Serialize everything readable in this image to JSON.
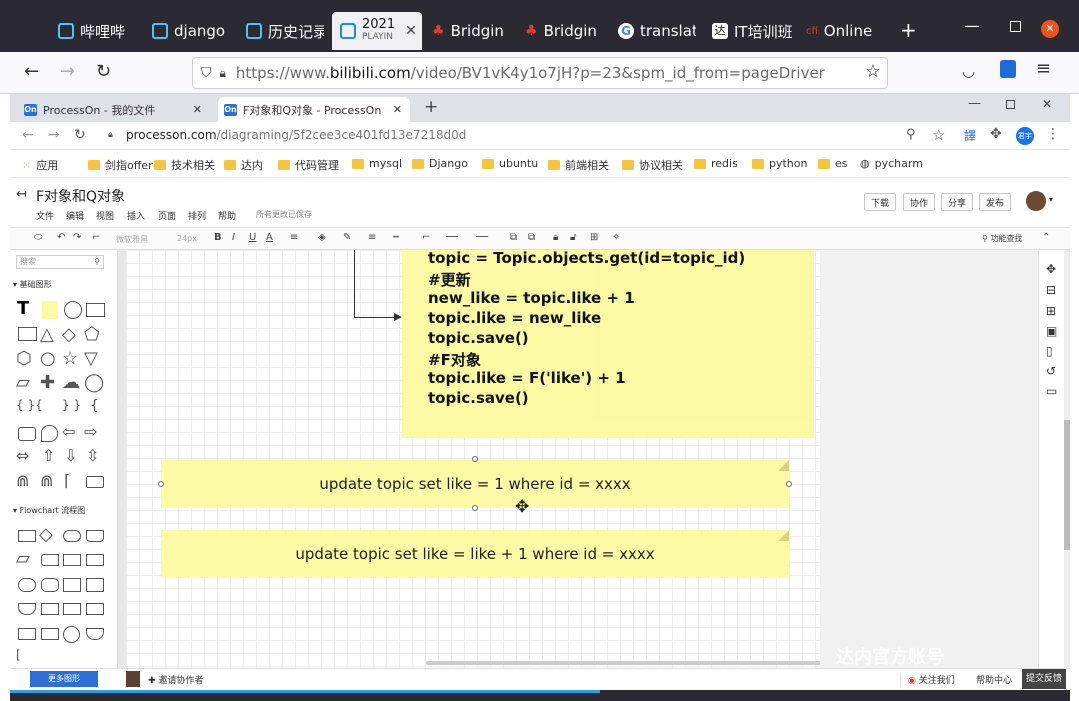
{
  "firefox": {
    "tabs": [
      {
        "label": "哔哩哔",
        "icon": "bilibili-icon"
      },
      {
        "label": "django",
        "icon": "bilibili-icon"
      },
      {
        "label": "历史记录",
        "icon": "bilibili-icon"
      },
      {
        "label": "2021",
        "sub": "PLAYIN",
        "icon": "bilibili-icon",
        "active": true
      },
      {
        "label": "Bridgin",
        "icon": "maple-leaf-icon"
      },
      {
        "label": "Bridgin",
        "icon": "maple-leaf-icon"
      },
      {
        "label": "translat",
        "icon": "google-icon"
      },
      {
        "label": "IT培训班",
        "icon": "tedu-icon"
      },
      {
        "label": "Online",
        "icon": "online-icon"
      }
    ],
    "url_prefix": "https://www.",
    "url_domain": "bilibili.com",
    "url_rest": "/video/BV1vK4y1o7jH?p=23&spm_id_from=pageDriver"
  },
  "chrome": {
    "tabs": [
      {
        "label": "ProcessOn - 我的文件"
      },
      {
        "label": "F对象和Q对象 - ProcessOn"
      }
    ],
    "url_domain": "processon.com",
    "url_path": "/diagraming/5f2cee3ce401fd13e7218d0d",
    "avatar": "君宇",
    "bookmarks": [
      "应用",
      "剑指offer",
      "技术相关",
      "达内",
      "代码管理",
      "mysql",
      "Django",
      "ubuntu",
      "前端相关",
      "协议相关",
      "redis",
      "python",
      "es",
      "pycharm"
    ]
  },
  "processon": {
    "title": "F对象和Q对象",
    "menu": [
      "文件",
      "编辑",
      "视图",
      "插入",
      "页面",
      "排列",
      "帮助"
    ],
    "saved_status": "所有更改已保存",
    "buttons": [
      "下载",
      "协作",
      "分享",
      "发布"
    ],
    "toolbar": {
      "font": "微软雅黑",
      "size": "24px",
      "search": "功能查找"
    },
    "left": {
      "search_placeholder": "搜索",
      "section_basic": "基础图形",
      "section_flowchart": "Flowchart 流程图",
      "more_shapes": "更多图形"
    },
    "canvas": {
      "code_lines": [
        "topic = Topic.objects.get(id=topic_id)",
        "#更新",
        "new_like = topic.like + 1",
        "topic.like = new_like",
        "topic.save()",
        "#F对象",
        "topic.like = F('like') + 1",
        "topic.save()"
      ],
      "note1": "update topic set like = 1 where id = xxxx",
      "note2": "update topic set like = like + 1 where id = xxxx"
    },
    "bottom": {
      "invite": "邀请协作者",
      "follow": "关注我们",
      "help": "帮助中心",
      "feedback": "提交反馈"
    },
    "watermark": "达内官方账号"
  },
  "colors": {
    "accent": "#2d6fd6",
    "note": "#fdfaa6",
    "dark": "#2b2a33"
  }
}
